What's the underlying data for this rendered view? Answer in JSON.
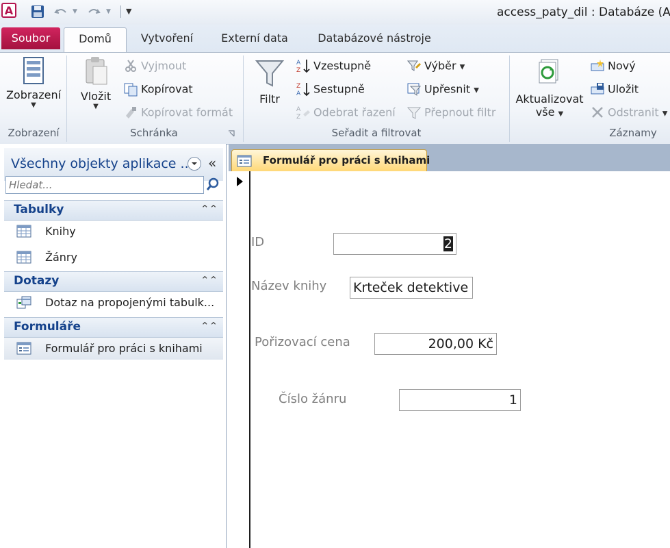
{
  "window": {
    "title": "access_paty_dil : Databáze (Acc"
  },
  "tabs": {
    "file": "Soubor",
    "home": "Domů",
    "create": "Vytvoření",
    "external": "Externí data",
    "dbtools": "Databázové nástroje"
  },
  "ribbon": {
    "views": {
      "button": "Zobrazení",
      "group": "Zobrazení"
    },
    "clipboard": {
      "paste": "Vložit",
      "cut": "Vyjmout",
      "copy": "Kopírovat",
      "format_painter": "Kopírovat formát",
      "group": "Schránka"
    },
    "sort_filter": {
      "filter": "Filtr",
      "ascending": "Vzestupně",
      "descending": "Sestupně",
      "remove_sort": "Odebrat řazení",
      "selection": "Výběr",
      "advanced": "Upřesnit",
      "toggle_filter": "Přepnout filtr",
      "group": "Seřadit a filtrovat"
    },
    "records": {
      "refresh_line1": "Aktualizovat",
      "refresh_line2": "vše",
      "new": "Nový",
      "save": "Uložit",
      "delete": "Odstranit",
      "group": "Záznamy"
    }
  },
  "nav": {
    "title": "Všechny objekty aplikace ...",
    "search_placeholder": "Hledat...",
    "sections": [
      {
        "label": "Tabulky",
        "items": [
          "Knihy",
          "Žánry"
        ]
      },
      {
        "label": "Dotazy",
        "items": [
          "Dotaz na propojenými tabulk..."
        ]
      },
      {
        "label": "Formuláře",
        "items": [
          "Formulář pro práci s knihami"
        ]
      }
    ]
  },
  "document": {
    "tab_title": "Formulář pro práci s knihami",
    "fields": {
      "id": {
        "label": "ID",
        "value": "2"
      },
      "title": {
        "label": "Název knihy",
        "value": "Krteček detektive"
      },
      "price": {
        "label": "Pořizovací cena",
        "value": "200,00 Kč"
      },
      "genre": {
        "label": "Číslo žánru",
        "value": "1"
      }
    }
  }
}
